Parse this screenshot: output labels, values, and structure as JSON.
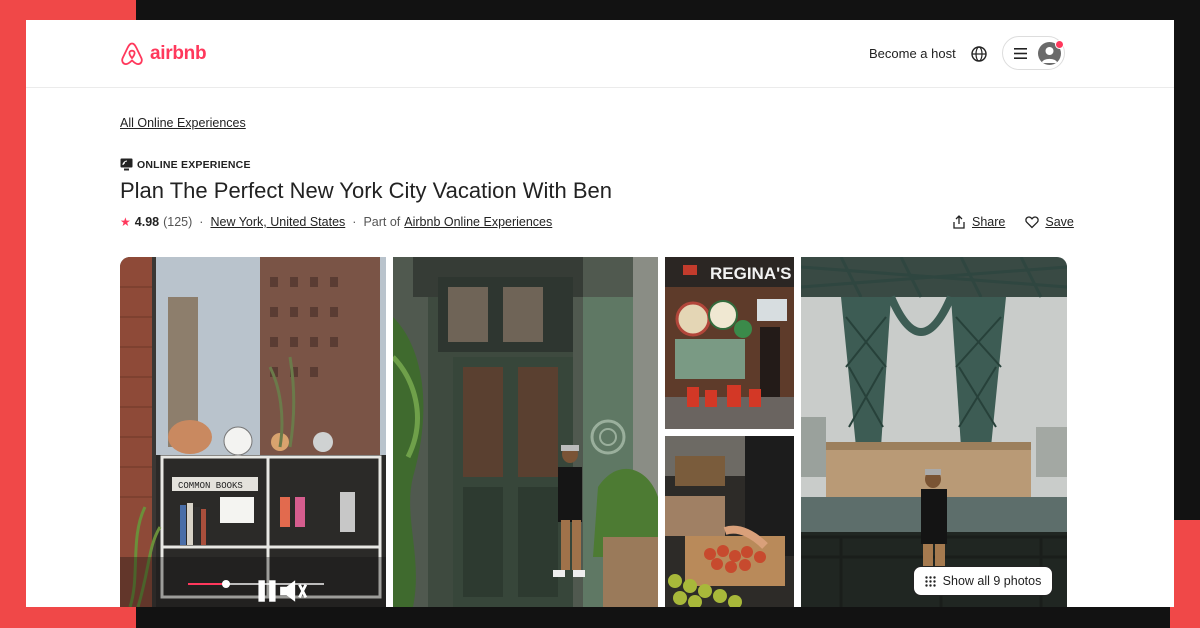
{
  "brand": {
    "name": "airbnb",
    "color": "#ff385c"
  },
  "header": {
    "become_host": "Become a host",
    "globe_icon": "globe-icon",
    "menu_icon": "hamburger-icon",
    "avatar_icon": "user-avatar-icon"
  },
  "breadcrumb": "All Online Experiences",
  "listing": {
    "tag": "ONLINE EXPERIENCE",
    "title": "Plan The Perfect New York City Vacation With Ben",
    "rating": "4.98",
    "review_count": "(125)",
    "location": "New York, United States",
    "part_of_prefix": "Part of",
    "part_of_link": "Airbnb Online Experiences"
  },
  "actions": {
    "share": "Share",
    "save": "Save"
  },
  "gallery": {
    "show_all": "Show all 9 photos",
    "video": {
      "progress": 0.28,
      "state": "playing"
    }
  }
}
